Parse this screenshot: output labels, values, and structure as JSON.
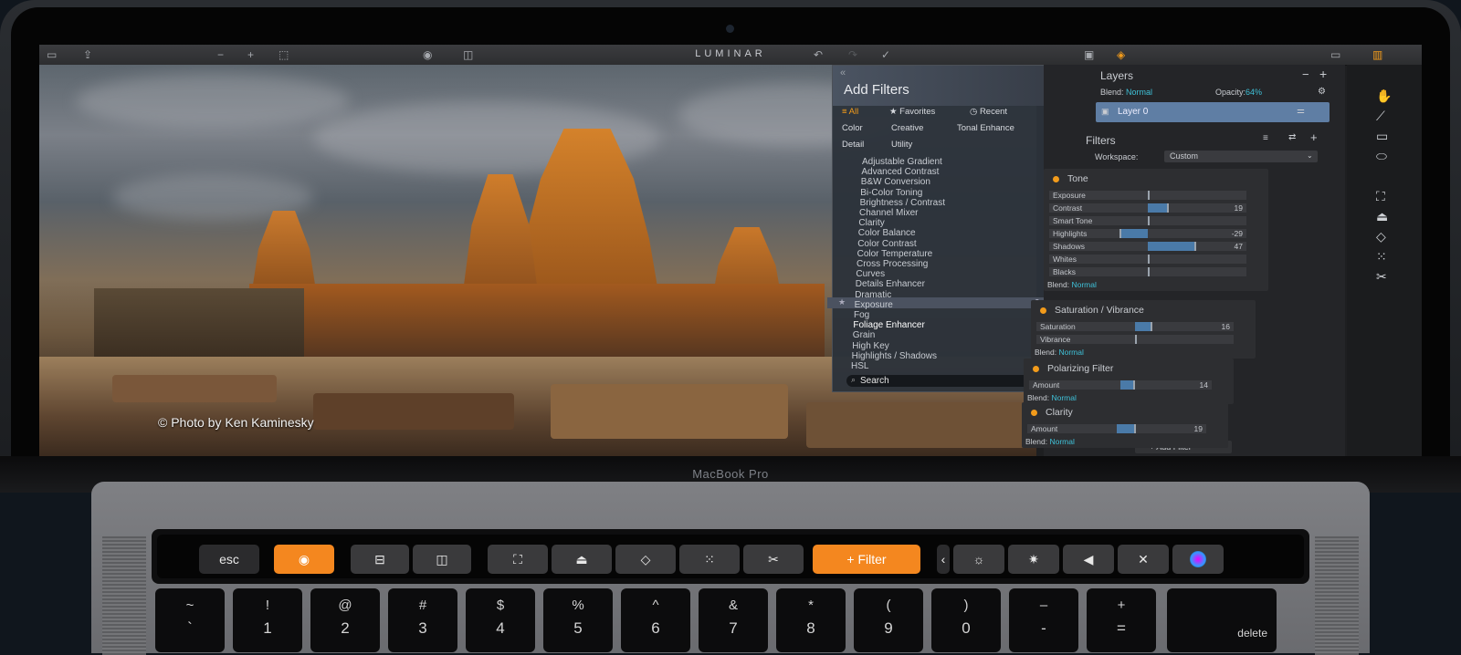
{
  "app": {
    "title": "LUMINAR",
    "device_label": "MacBook Pro"
  },
  "toolbar": {
    "icons": [
      "folder-icon",
      "share-icon",
      "zoom-out-icon",
      "zoom-in-icon",
      "fit-icon",
      "eye-icon",
      "compare-icon",
      "undo-icon",
      "redo-icon",
      "history-icon",
      "image-icon",
      "layers-icon",
      "panel-icon",
      "sidebar-icon"
    ]
  },
  "photo": {
    "credit": "© Photo by Ken Kaminesky"
  },
  "add_filters": {
    "title": "Add Filters",
    "categories_row1": [
      "All",
      "Favorites",
      "Recent"
    ],
    "categories_row2": [
      "Color",
      "Creative",
      "Tonal Enhance"
    ],
    "categories_row3": [
      "Detail",
      "Utility"
    ],
    "items": [
      "Adjustable Gradient",
      "Advanced Contrast",
      "B&W Conversion",
      "Bi-Color Toning",
      "Brightness / Contrast",
      "Channel Mixer",
      "Clarity",
      "Color Balance",
      "Color Contrast",
      "Color Temperature",
      "Cross Processing",
      "Curves",
      "Details Enhancer",
      "Dramatic",
      "Exposure",
      "Fog",
      "Foliage Enhancer",
      "Grain",
      "High Key",
      "Highlights / Shadows",
      "HSL"
    ],
    "selected": "Foliage Enhancer",
    "search_placeholder": "Search"
  },
  "layers": {
    "title": "Layers",
    "blend_label": "Blend:",
    "blend_value": "Normal",
    "opacity_label": "Opacity:",
    "opacity_value": "64%",
    "layer_name": "Layer 0"
  },
  "filters_panel": {
    "title": "Filters",
    "workspace_label": "Workspace:",
    "workspace_value": "Custom",
    "tone": {
      "title": "Tone",
      "sliders": [
        {
          "label": "Exposure",
          "value": "",
          "level": 0.0
        },
        {
          "label": "Contrast",
          "value": "19",
          "level": 0.19
        },
        {
          "label": "Smart Tone",
          "value": "",
          "level": 0.0
        },
        {
          "label": "Highlights",
          "value": "-29",
          "level": -0.29
        },
        {
          "label": "Shadows",
          "value": "47",
          "level": 0.47
        },
        {
          "label": "Whites",
          "value": "",
          "level": 0.0
        },
        {
          "label": "Blacks",
          "value": "",
          "level": 0.0
        }
      ],
      "blend_label": "Blend:",
      "blend_value": "Normal"
    },
    "saturation": {
      "title": "Saturation / Vibrance",
      "sliders": [
        {
          "label": "Saturation",
          "value": "16",
          "level": 0.16
        },
        {
          "label": "Vibrance",
          "value": "",
          "level": 0.0
        }
      ],
      "blend_label": "Blend:",
      "blend_value": "Normal"
    },
    "polarizing": {
      "title": "Polarizing Filter",
      "sliders": [
        {
          "label": "Amount",
          "value": "14",
          "level": 0.14
        }
      ],
      "blend_label": "Blend:",
      "blend_value": "Normal"
    },
    "clarity": {
      "title": "Clarity",
      "sliders": [
        {
          "label": "Amount",
          "value": "19",
          "level": 0.19
        }
      ],
      "blend_label": "Blend:",
      "blend_value": "Normal"
    },
    "add_filter_label": "+ Add Filter"
  },
  "touchbar": {
    "esc": "esc",
    "filter_label": "+ Filter"
  },
  "keys": [
    {
      "top": "~",
      "bot": "`"
    },
    {
      "top": "!",
      "bot": "1"
    },
    {
      "top": "@",
      "bot": "2"
    },
    {
      "top": "#",
      "bot": "3"
    },
    {
      "top": "$",
      "bot": "4"
    },
    {
      "top": "%",
      "bot": "5"
    },
    {
      "top": "^",
      "bot": "6"
    },
    {
      "top": "&",
      "bot": "7"
    },
    {
      "top": "*",
      "bot": "8"
    },
    {
      "top": "(",
      "bot": "9"
    },
    {
      "top": ")",
      "bot": "0"
    },
    {
      "top": "–",
      "bot": "-"
    },
    {
      "top": "+",
      "bot": "="
    }
  ],
  "delete_key": "delete",
  "colors": {
    "accent_orange": "#f4871f",
    "accent_cyan": "#3fc1d8",
    "layer_blue": "#5f7ea4"
  }
}
